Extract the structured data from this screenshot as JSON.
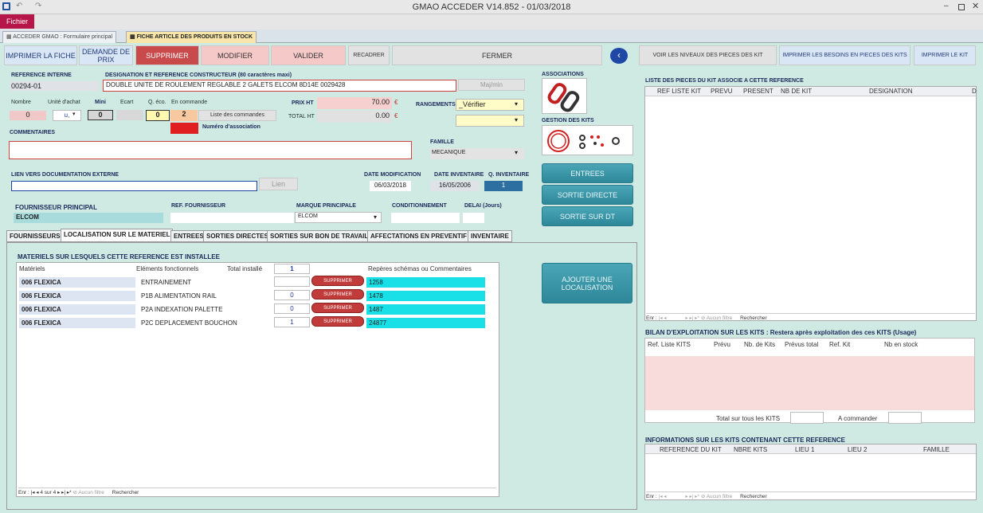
{
  "window": {
    "title": "GMAO ACCEDER V14.852 - 01/03/2018"
  },
  "ribbon": {
    "file_label": "Fichier"
  },
  "doc_tabs": [
    {
      "label": "ACCEDER GMAO : Formulaire principal"
    },
    {
      "label": "FICHE ARTICLE DES PRODUITS EN STOCK"
    }
  ],
  "toolbar": {
    "imprimer_fiche": "IMPRIMER LA FICHE",
    "demande_prix": "DEMANDE DE PRIX",
    "supprimer": "SUPPRIMER",
    "modifier": "MODIFIER",
    "valider": "VALIDER",
    "recadrer": "RECADRER",
    "fermer": "FERMER",
    "voir_niveaux": "VOIR LES NIVEAUX DES PIECES DES KIT",
    "imprimer_besoins": "IMPRIMER LES BESOINS EN PIECES DES KITS",
    "imprimer_kit": "IMPRIMER LE KIT"
  },
  "form": {
    "ref_interne_label": "REFERENCE INTERNE",
    "ref_interne": "00294-01",
    "designation_label": "DESIGNATION ET REFERENCE CONSTRUCTEUR (80 caractères maxi)",
    "designation": "DOUBLE UNITE DE ROULEMENT REGLABLE 2 GALETS ELCOM  8D14E 0029428",
    "majmin": "Maj/min",
    "nombre_label": "Nombre",
    "nombre": "0",
    "unite_label": "Unité d'achat",
    "unite": "u,",
    "mini_label": "Mini",
    "mini": "0",
    "ecart_label": "Ecart",
    "qeco_label": "Q. éco.",
    "qeco": "0",
    "encommande_label": "En commande",
    "encommande": "2",
    "liste_commandes": "Liste des commandes",
    "num_assoc": "Numéro d'association",
    "prixht_label": "PRIX HT",
    "prixht": "70.00",
    "totalht_label": "TOTAL HT",
    "totalht": "0.00",
    "currency": "€",
    "rangements_label": "RANGEMENTS",
    "rangement": "_Vérifier",
    "commentaires_label": "COMMENTAIRES",
    "famille_label": "FAMILLE",
    "famille": "MECANIQUE",
    "lien_label": "LIEN VERS DOCUMENTATION EXTERNE",
    "lien_btn": "Lien",
    "datemod_label": "DATE MODIFICATION",
    "datemod": "06/03/2018",
    "dateinv_label": "DATE INVENTAIRE",
    "dateinv": "16/05/2006",
    "qinv_label": "Q. INVENTAIRE",
    "qinv": "1",
    "fournisseur_label": "FOURNISSEUR PRINCIPAL",
    "fournisseur": "ELCOM",
    "reffourn_label": "REF. FOURNISSEUR",
    "marque_label": "MARQUE PRINCIPALE",
    "marque": "ELCOM",
    "cond_label": "CONDITIONNEMENT",
    "delai_label": "DELAI (Jours)"
  },
  "assoc": {
    "associations_label": "ASSOCIATIONS",
    "gestion_kits_label": "GESTION DES KITS",
    "entrees": "ENTREES",
    "sortie_directe": "SORTIE DIRECTE",
    "sortie_dt": "SORTIE SUR DT"
  },
  "subtabs": [
    {
      "label": "FOURNISSEURS"
    },
    {
      "label": "LOCALISATION SUR LE MATERIEL"
    },
    {
      "label": "ENTREES"
    },
    {
      "label": "SORTIES DIRECTES"
    },
    {
      "label": "SORTIES SUR BON DE TRAVAIL"
    },
    {
      "label": "AFFECTATIONS EN PREVENTIF"
    },
    {
      "label": "INVENTAIRE"
    }
  ],
  "localisation": {
    "title": "MATERIELS SUR LESQUELS  CETTE REFERENCE EST INSTALLEE",
    "col_materiels": "Matériels",
    "col_elements": "Eléments fonctionnels",
    "col_total": "Total installé",
    "total": "1",
    "col_reperes": "Repères schémas ou Commentaires",
    "ajouter": "AJOUTER UNE LOCALISATION",
    "rows": [
      {
        "materiel": "006 FLEXICA",
        "element": "ENTRAINEMENT",
        "qty": "",
        "supp": "SUPPRIMER",
        "repere": "1258"
      },
      {
        "materiel": "006 FLEXICA",
        "element": "P1B ALIMENTATION RAIL",
        "qty": "0",
        "supp": "SUPPRIMER",
        "repere": "1478"
      },
      {
        "materiel": "006 FLEXICA",
        "element": "P2A INDEXATION PALETTE",
        "qty": "0",
        "supp": "SUPPRIMER",
        "repere": "1487"
      },
      {
        "materiel": "006 FLEXICA",
        "element": "P2C DEPLACEMENT BOUCHON",
        "qty": "1",
        "supp": "SUPPRIMER",
        "repere": "24877"
      }
    ],
    "nav": {
      "enr": "Enr :",
      "pos": "4 sur 4",
      "filtre": "Aucun filtre",
      "rech": "Rechercher"
    }
  },
  "kit_list": {
    "title": "LISTE DES PIECES DU KIT ASSOCIE A CETTE REFERENCE",
    "cols": [
      "REF LISTE KIT",
      "PREVU",
      "PRESENT",
      "NB DE KIT",
      "DESIGNATION",
      "D"
    ],
    "nav": {
      "enr": "Enr :",
      "filtre": "Aucun filtre",
      "rech": "Rechercher"
    }
  },
  "bilan": {
    "title": "BILAN D'EXPLOITATION SUR LES KITS : Restera après exploitation des ces KITS (Usage)",
    "cols": [
      "Ref. Liste KITS",
      "Prévu",
      "Nb. de Kits",
      "Prévus total",
      "Ref. Kit",
      "Nb en stock"
    ],
    "total_label": "Total sur tous les KITS",
    "acommander_label": "A commander"
  },
  "infos": {
    "title": "INFORMATIONS SUR LES KITS CONTENANT CETTE REFERENCE",
    "cols": [
      "REFERENCE DU KIT",
      "NBRE KITS",
      "LIEU 1",
      "LIEU 2",
      "FAMILLE"
    ],
    "nav": {
      "enr": "Enr :",
      "filtre": "Aucun filtre",
      "rech": "Rechercher"
    }
  }
}
